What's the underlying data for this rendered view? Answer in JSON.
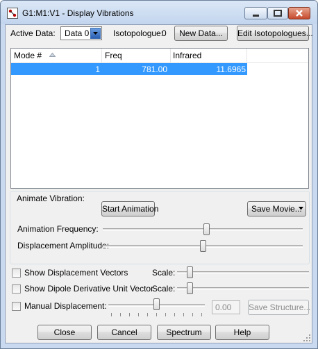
{
  "window": {
    "title": "G1:M1:V1 - Display Vibrations"
  },
  "header": {
    "active_data_label": "Active Data:",
    "active_data_value": "Data 0",
    "isotopologue_label": "Isotopologue:",
    "isotopologue_value": "0",
    "new_data_button": "New Data...",
    "edit_isotopologues_button": "Edit Isotopologues..."
  },
  "table": {
    "columns": [
      "Mode #",
      "Freq",
      "Infrared"
    ],
    "rows": [
      {
        "mode": "1",
        "freq": "781.00",
        "infrared": "11.6965"
      }
    ]
  },
  "animate": {
    "group_label": "Animate Vibration:",
    "start_button": "Start Animation",
    "save_movie_button": "Save Movie...",
    "frequency_label": "Animation Frequency:",
    "frequency_level": 0.52,
    "amplitude_label": "Displacement Amplitude:",
    "amplitude_level": 0.5
  },
  "options": {
    "show_vectors_label": "Show Displacement Vectors",
    "show_vectors_checked": false,
    "vectors_scale_label": "Scale:",
    "vectors_scale_level": 0.08,
    "show_dipole_label": "Show Dipole Derivative Unit Vector",
    "show_dipole_checked": false,
    "dipole_scale_label": "Scale:",
    "dipole_scale_level": 0.08,
    "manual_label": "Manual Displacement:",
    "manual_checked": false,
    "manual_level": 0.5,
    "manual_value": "0.00",
    "save_structure_button": "Save Structure..."
  },
  "footer": {
    "close_button": "Close",
    "cancel_button": "Cancel",
    "spectrum_button": "Spectrum",
    "help_button": "Help"
  },
  "colors": {
    "selection": "#3399ff",
    "window_frame": "#c9daf0",
    "client_bg": "#f0f0f0"
  }
}
